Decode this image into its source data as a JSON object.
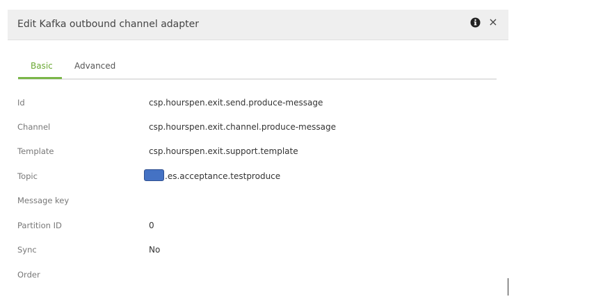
{
  "dialog": {
    "title": "Edit Kafka outbound channel adapter",
    "info_icon": "info-icon",
    "close_glyph": "×"
  },
  "tabs": [
    {
      "label": "Basic",
      "active": true
    },
    {
      "label": "Advanced",
      "active": false
    }
  ],
  "colors": {
    "accent": "#7ab648",
    "header_bg": "#efefef",
    "redaction": "#4472c4"
  },
  "fields": [
    {
      "label": "Id",
      "value": "csp.hourspen.exit.send.produce-message"
    },
    {
      "label": "Channel",
      "value": "csp.hourspen.exit.channel.produce-message"
    },
    {
      "label": "Template",
      "value": "csp.hourspen.exit.support.template"
    },
    {
      "label": "Topic",
      "value": ".es.acceptance.testproduce"
    },
    {
      "label": "Message key",
      "value": ""
    },
    {
      "label": "Partition ID",
      "value": "0"
    },
    {
      "label": "Sync",
      "value": "No"
    },
    {
      "label": "Order",
      "value": ""
    }
  ]
}
